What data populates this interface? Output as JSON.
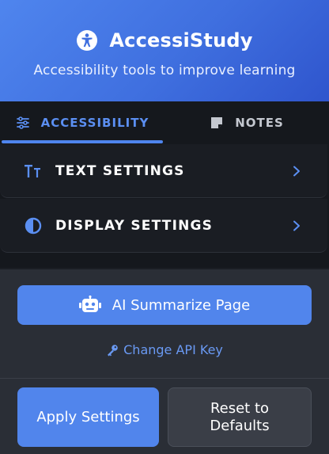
{
  "header": {
    "title": "AccessiStudy",
    "subtitle": "Accessibility tools to improve learning",
    "icon": "accessibility-person-icon"
  },
  "tabs": [
    {
      "label": "ACCESSIBILITY",
      "icon": "sliders-icon",
      "active": true
    },
    {
      "label": "NOTES",
      "icon": "note-icon",
      "active": false
    }
  ],
  "sections": [
    {
      "label": "TEXT SETTINGS",
      "icon": "text-size-icon"
    },
    {
      "label": "DISPLAY SETTINGS",
      "icon": "contrast-icon"
    }
  ],
  "ai": {
    "summarize_label": "AI Summarize Page",
    "summarize_icon": "robot-icon",
    "api_key_label": "Change API Key",
    "api_key_icon": "key-icon"
  },
  "footer": {
    "apply_label": "Apply Settings",
    "reset_label": "Reset to Defaults"
  },
  "colors": {
    "accent": "#4f85ee",
    "header_start": "#4f85ee",
    "header_end": "#2f55cd",
    "background": "#1b1e24",
    "link": "#6a9af4"
  }
}
